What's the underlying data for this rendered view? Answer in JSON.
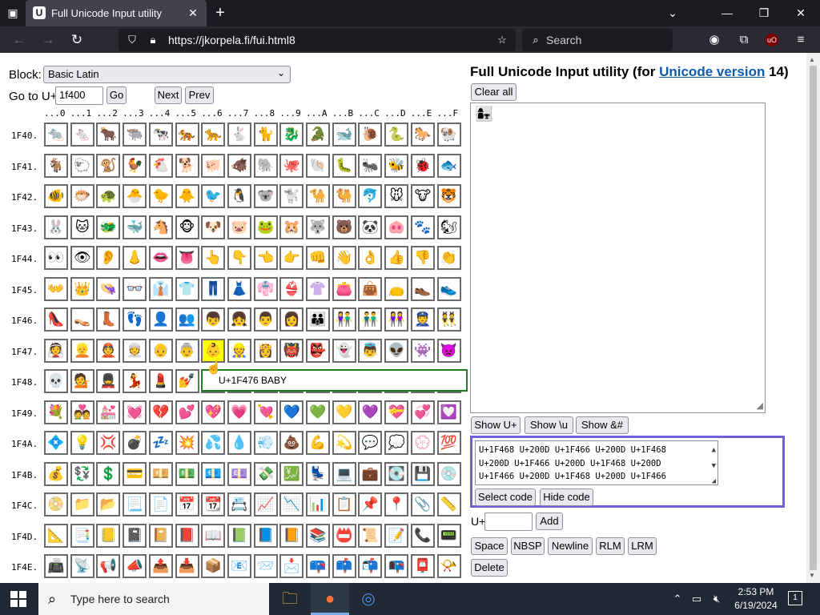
{
  "browser": {
    "tab_title": "Full Unicode Input utility",
    "tab_favicon": "U",
    "url": "https://jkorpela.fi/fui.html8",
    "search_placeholder": "Search",
    "new_tab": "+",
    "close_tab": "✕",
    "icons": {
      "tab_list": "tab-list-icon",
      "back": "back-arrow-icon",
      "forward": "forward-arrow-icon",
      "reload": "reload-icon",
      "tracking": "shield-icon",
      "lock": "lock-icon",
      "bookmark": "star-icon",
      "search": "search-icon",
      "account": "account-icon",
      "extensions": "extensions-icon",
      "ublock": "ublock-origin-icon",
      "menu": "hamburger-menu-icon",
      "minimize": "minimize-icon",
      "restore": "restore-icon",
      "close": "close-icon",
      "list_all_tabs": "chevron-down-icon"
    }
  },
  "controls": {
    "block_label": "Block:",
    "block_value": "Basic Latin",
    "goto_label": "Go to U+",
    "goto_value": "1f400",
    "go": "Go",
    "next": "Next",
    "prev": "Prev"
  },
  "grid": {
    "columns": [
      "...0",
      "...1",
      "...2",
      "...3",
      "...4",
      "...5",
      "...6",
      "...7",
      "...8",
      "...9",
      "...A",
      "...B",
      "...C",
      "...D",
      "...E",
      "...F"
    ],
    "rows": [
      {
        "label": "1F40.",
        "chars": [
          "🐀",
          "🐁",
          "🐂",
          "🐃",
          "🐄",
          "🐅",
          "🐆",
          "🐇",
          "🐈",
          "🐉",
          "🐊",
          "🐋",
          "🐌",
          "🐍",
          "🐎",
          "🐏"
        ]
      },
      {
        "label": "1F41.",
        "chars": [
          "🐐",
          "🐑",
          "🐒",
          "🐓",
          "🐔",
          "🐕",
          "🐖",
          "🐗",
          "🐘",
          "🐙",
          "🐚",
          "🐛",
          "🐜",
          "🐝",
          "🐞",
          "🐟"
        ]
      },
      {
        "label": "1F42.",
        "chars": [
          "🐠",
          "🐡",
          "🐢",
          "🐣",
          "🐤",
          "🐥",
          "🐦",
          "🐧",
          "🐨",
          "🐩",
          "🐪",
          "🐫",
          "🐬",
          "🐭",
          "🐮",
          "🐯"
        ]
      },
      {
        "label": "1F43.",
        "chars": [
          "🐰",
          "🐱",
          "🐲",
          "🐳",
          "🐴",
          "🐵",
          "🐶",
          "🐷",
          "🐸",
          "🐹",
          "🐺",
          "🐻",
          "🐼",
          "🐽",
          "🐾",
          "🐿"
        ]
      },
      {
        "label": "1F44.",
        "chars": [
          "👀",
          "👁",
          "👂",
          "👃",
          "👄",
          "👅",
          "👆",
          "👇",
          "👈",
          "👉",
          "👊",
          "👋",
          "👌",
          "👍",
          "👎",
          "👏"
        ]
      },
      {
        "label": "1F45.",
        "chars": [
          "👐",
          "👑",
          "👒",
          "👓",
          "👔",
          "👕",
          "👖",
          "👗",
          "👘",
          "👙",
          "👚",
          "👛",
          "👜",
          "👝",
          "👞",
          "👟"
        ]
      },
      {
        "label": "1F46.",
        "chars": [
          "👠",
          "👡",
          "👢",
          "👣",
          "👤",
          "👥",
          "👦",
          "👧",
          "👨",
          "👩",
          "👪",
          "👫",
          "👬",
          "👭",
          "👮",
          "👯"
        ]
      },
      {
        "label": "1F47.",
        "chars": [
          "👰",
          "👱",
          "👲",
          "👳",
          "👴",
          "👵",
          "👶",
          "👷",
          "👸",
          "👹",
          "👺",
          "👻",
          "👼",
          "👽",
          "👾",
          "👿"
        ]
      },
      {
        "label": "1F48.",
        "chars": [
          "💀",
          "💁",
          "💂",
          "💃",
          "💄",
          "💅",
          "💆",
          "💇",
          "💈",
          "💉",
          "💊",
          "💋",
          "💌",
          "💍",
          "💎",
          "💏"
        ]
      },
      {
        "label": "1F49.",
        "chars": [
          "💐",
          "💑",
          "💒",
          "💓",
          "💔",
          "💕",
          "💖",
          "💗",
          "💘",
          "💙",
          "💚",
          "💛",
          "💜",
          "💝",
          "💞",
          "💟"
        ]
      },
      {
        "label": "1F4A.",
        "chars": [
          "💠",
          "💡",
          "💢",
          "💣",
          "💤",
          "💥",
          "💦",
          "💧",
          "💨",
          "💩",
          "💪",
          "💫",
          "💬",
          "💭",
          "💮",
          "💯"
        ]
      },
      {
        "label": "1F4B.",
        "chars": [
          "💰",
          "💱",
          "💲",
          "💳",
          "💴",
          "💵",
          "💶",
          "💷",
          "💸",
          "💹",
          "💺",
          "💻",
          "💼",
          "💽",
          "💾",
          "💿"
        ]
      },
      {
        "label": "1F4C.",
        "chars": [
          "📀",
          "📁",
          "📂",
          "📃",
          "📄",
          "📅",
          "📆",
          "📇",
          "📈",
          "📉",
          "📊",
          "📋",
          "📌",
          "📍",
          "📎",
          "📏"
        ]
      },
      {
        "label": "1F4D.",
        "chars": [
          "📐",
          "📑",
          "📒",
          "📓",
          "📔",
          "📕",
          "📖",
          "📗",
          "📘",
          "📙",
          "📚",
          "📛",
          "📜",
          "📝",
          "📞",
          "📟"
        ]
      },
      {
        "label": "1F4E.",
        "chars": [
          "📠",
          "📡",
          "📢",
          "📣",
          "📤",
          "📥",
          "📦",
          "📧",
          "📨",
          "📩",
          "📪",
          "📫",
          "📬",
          "📭",
          "📮",
          "📯"
        ]
      }
    ],
    "highlighted": {
      "row": 7,
      "col": 6
    },
    "tooltip": "U+1F476 BABY"
  },
  "panel": {
    "title_prefix": "Full Unicode Input utility (for ",
    "title_link": "Unicode version",
    "title_suffix": " 14)",
    "clear_all": "Clear all",
    "output_char": "👩‍👧",
    "show_uplus": "Show U+",
    "show_u": "Show \\u",
    "show_amp": "Show &#",
    "code_text": "U+1F468 U+200D U+1F466 U+200D U+1F468 U+200D U+1F466 U+200D U+1F468 U+200D U+1F466 U+200D U+1F468 U+200D U+1F466",
    "select_code": "Select code",
    "hide_code": "Hide code",
    "uplus_label": "U+",
    "add": "Add",
    "space": "Space",
    "nbsp": "NBSP",
    "newline": "Newline",
    "rlm": "RLM",
    "lrm": "LRM",
    "delete": "Delete"
  },
  "taskbar": {
    "search_placeholder": "Type here to search",
    "time": "2:53 PM",
    "date": "6/19/2024",
    "notifications": "1",
    "apps": [
      "file-explorer-icon",
      "firefox-icon",
      "chrome-icon"
    ]
  }
}
